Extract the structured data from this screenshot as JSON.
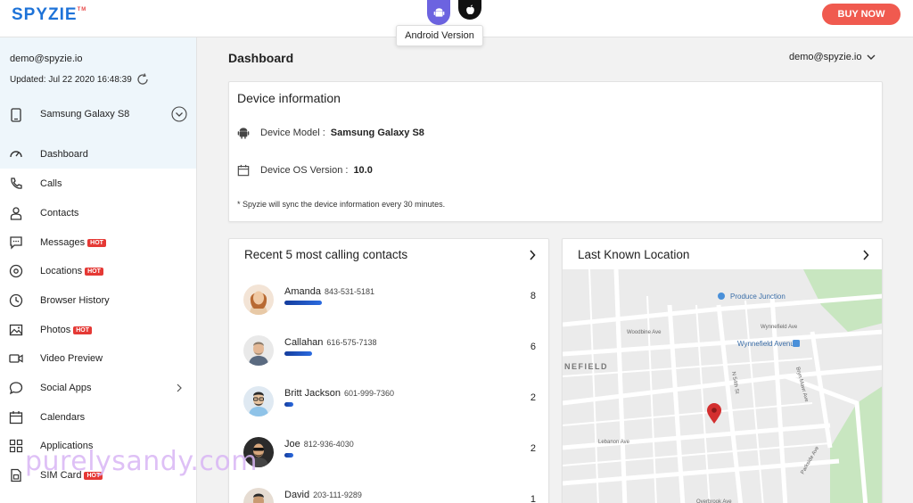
{
  "brand": {
    "logo": "SPYZIE",
    "logo_mark": "TM"
  },
  "top": {
    "tooltip": "Android Version",
    "buy_now": "BUY NOW"
  },
  "account": {
    "email": "demo@spyzie.io",
    "updated": "Updated: Jul 22 2020 16:48:39"
  },
  "device": {
    "name": "Samsung Galaxy S8"
  },
  "nav": [
    {
      "label": "Dashboard",
      "hot": "",
      "icon": "dashboard-icon"
    },
    {
      "label": "Calls",
      "hot": "",
      "icon": "phone-icon"
    },
    {
      "label": "Contacts",
      "hot": "",
      "icon": "person-icon"
    },
    {
      "label": "Messages",
      "hot": "HOT",
      "icon": "message-icon"
    },
    {
      "label": "Locations",
      "hot": "HOT",
      "icon": "location-icon"
    },
    {
      "label": "Browser History",
      "hot": "",
      "icon": "clock-icon"
    },
    {
      "label": "Photos",
      "hot": "HOT",
      "icon": "image-icon"
    },
    {
      "label": "Video Preview",
      "hot": "",
      "icon": "video-icon"
    },
    {
      "label": "Social Apps",
      "hot": "",
      "icon": "chat-bubble-icon"
    },
    {
      "label": "Calendars",
      "hot": "",
      "icon": "calendar-icon"
    },
    {
      "label": "Applications",
      "hot": "",
      "icon": "apps-grid-icon"
    },
    {
      "label": "SIM Card",
      "hot": "HOT",
      "icon": "sim-card-icon"
    }
  ],
  "main": {
    "title": "Dashboard",
    "user_email": "demo@spyzie.io"
  },
  "device_info": {
    "title": "Device information",
    "model_label": "Device Model :",
    "model_value": "Samsung Galaxy S8",
    "os_label": "Device OS Version :",
    "os_value": "10.0",
    "note": "* Spyzie will sync the device information every 30 minutes."
  },
  "calls": {
    "title": "Recent 5 most calling contacts",
    "contacts": [
      {
        "name": "Amanda",
        "phone": "843-531-5181",
        "count": "8",
        "share": 0.8
      },
      {
        "name": "Callahan",
        "phone": "616-575-7138",
        "count": "6",
        "share": 0.6
      },
      {
        "name": "Britt Jackson",
        "phone": "601-999-7360",
        "count": "2",
        "share": 0.2
      },
      {
        "name": "Joe",
        "phone": "812-936-4030",
        "count": "2",
        "share": 0.2
      },
      {
        "name": "David",
        "phone": "203-111-9289",
        "count": "1",
        "share": 0.1
      }
    ]
  },
  "location": {
    "title": "Last Known Location",
    "map_labels": {
      "poi1": "Produce Junction",
      "poi2": "Wynnefield Avenue",
      "area": "NEFIELD",
      "st1": "Wynnefield Ave",
      "st2": "Woodbine Ave",
      "st3": "Lebanon Ave",
      "st4": "Overbrook Ave",
      "st5": "Bryn Mawr Ave",
      "st6": "N 54th St",
      "st7": "Parkside Ave"
    }
  },
  "watermark": "purelysandy.com",
  "colors": {
    "brand_blue": "#1e73d8",
    "buy_red": "#f05a4f",
    "hot_red": "#e53935",
    "android_purple": "#6c63e0",
    "pin_red": "#d32f2f",
    "park_green": "#c8e6c0"
  }
}
